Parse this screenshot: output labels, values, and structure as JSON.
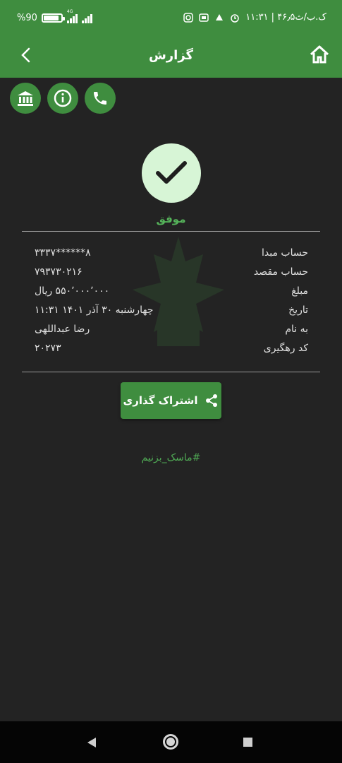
{
  "status_bar": {
    "battery": "%90",
    "network": "4G",
    "time": "۱۱:۳۱ | ۴۶٫۵ک.ب/ث"
  },
  "app_bar": {
    "title": "گزارش"
  },
  "receipt": {
    "status": "موفق",
    "rows": [
      {
        "label": "حساب مبدا",
        "value": "۸******۳۳۳۷"
      },
      {
        "label": "حساب مقصد",
        "value": "۷۹۳۷۳۰۲۱۶"
      },
      {
        "label": "مبلغ",
        "value": "۵۵۰٬۰۰۰٬۰۰۰ ریال"
      },
      {
        "label": "تاریخ",
        "value": "چهارشنبه ۳۰ آذر ۱۴۰۱ ۱۱:۳۱"
      },
      {
        "label": "به نام",
        "value": "رضا عبداللهی"
      },
      {
        "label": "کد رهگیری",
        "value": "۲۰۲۷۳"
      }
    ]
  },
  "share": {
    "label": "اشتراک گذاری"
  },
  "hashtag": "#ماسک_بزنیم",
  "icons": {
    "bank": "bank-icon",
    "info": "info-icon",
    "phone": "phone-icon",
    "home": "home-icon",
    "back": "chevron-left-icon",
    "check": "checkmark-icon",
    "share": "share-icon"
  },
  "colors": {
    "primary": "#3f8d3f",
    "success_text": "#55b35a",
    "background": "#232323",
    "check_bg": "#d7f5d6"
  }
}
